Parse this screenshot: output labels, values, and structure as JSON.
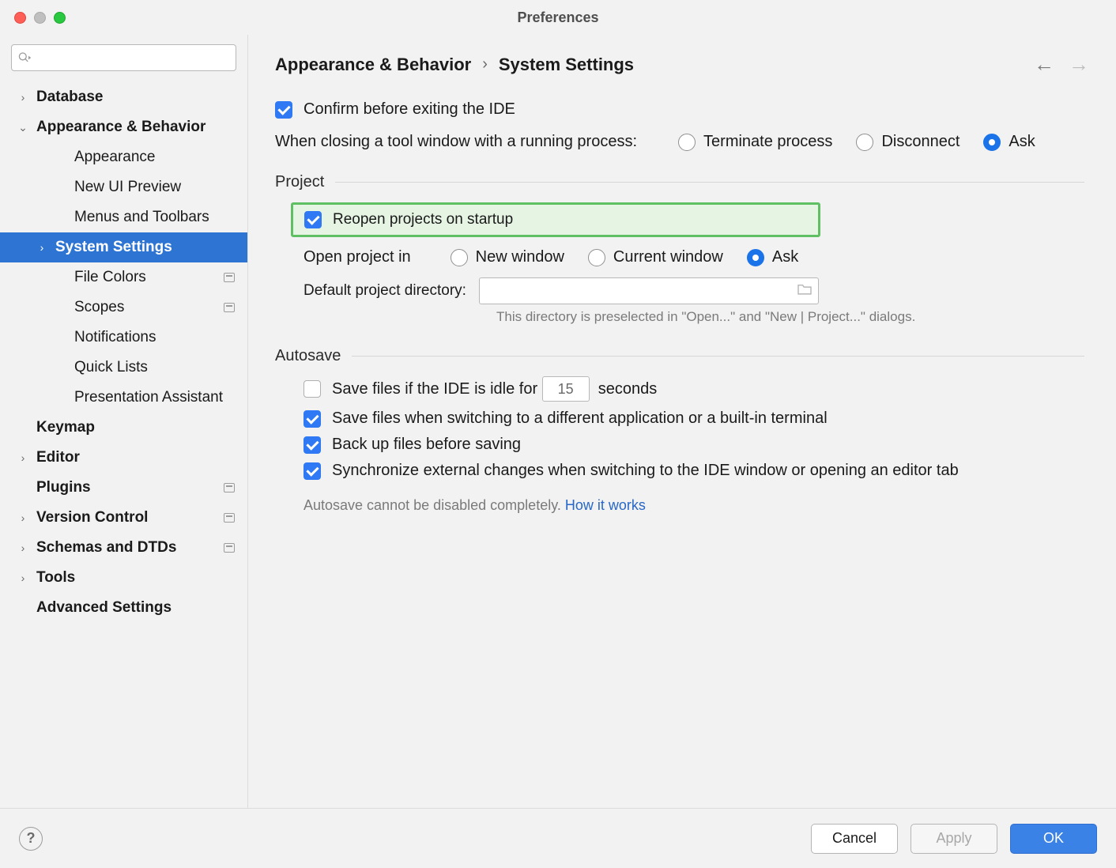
{
  "window": {
    "title": "Preferences"
  },
  "search": {
    "placeholder": ""
  },
  "sidebar": {
    "items": [
      {
        "label": "Database",
        "bold": true,
        "arrow": "right",
        "pad": 0
      },
      {
        "label": "Appearance & Behavior",
        "bold": true,
        "arrow": "down",
        "pad": 0
      },
      {
        "label": "Appearance",
        "bold": false,
        "arrow": "",
        "pad": 2
      },
      {
        "label": "New UI Preview",
        "bold": false,
        "arrow": "",
        "pad": 2
      },
      {
        "label": "Menus and Toolbars",
        "bold": false,
        "arrow": "",
        "pad": 2
      },
      {
        "label": "System Settings",
        "bold": true,
        "arrow": "right",
        "pad": 1,
        "selected": true
      },
      {
        "label": "File Colors",
        "bold": false,
        "arrow": "",
        "pad": 2,
        "badge": true
      },
      {
        "label": "Scopes",
        "bold": false,
        "arrow": "",
        "pad": 2,
        "badge": true
      },
      {
        "label": "Notifications",
        "bold": false,
        "arrow": "",
        "pad": 2
      },
      {
        "label": "Quick Lists",
        "bold": false,
        "arrow": "",
        "pad": 2
      },
      {
        "label": "Presentation Assistant",
        "bold": false,
        "arrow": "",
        "pad": 2
      },
      {
        "label": "Keymap",
        "bold": true,
        "arrow": "",
        "pad": 0,
        "noarrow": true
      },
      {
        "label": "Editor",
        "bold": true,
        "arrow": "right",
        "pad": 0
      },
      {
        "label": "Plugins",
        "bold": true,
        "arrow": "",
        "pad": 0,
        "noarrow": true,
        "badge": true
      },
      {
        "label": "Version Control",
        "bold": true,
        "arrow": "right",
        "pad": 0,
        "badge": true
      },
      {
        "label": "Schemas and DTDs",
        "bold": true,
        "arrow": "right",
        "pad": 0,
        "badge": true
      },
      {
        "label": "Tools",
        "bold": true,
        "arrow": "right",
        "pad": 0
      },
      {
        "label": "Advanced Settings",
        "bold": true,
        "arrow": "",
        "pad": 0,
        "noarrow": true
      }
    ]
  },
  "breadcrumb": {
    "a": "Appearance & Behavior",
    "sep": "›",
    "b": "System Settings"
  },
  "confirm_exit": "Confirm before exiting the IDE",
  "close_tool": {
    "label": "When closing a tool window with a running process:",
    "opts": [
      "Terminate process",
      "Disconnect",
      "Ask"
    ],
    "selected": 2
  },
  "sections": {
    "project": "Project",
    "autosave": "Autosave"
  },
  "project": {
    "reopen": "Reopen projects on startup",
    "open_in_label": "Open project in",
    "open_in_opts": [
      "New window",
      "Current window",
      "Ask"
    ],
    "open_in_selected": 2,
    "dir_label": "Default project directory:",
    "dir_value": "",
    "dir_hint": "This directory is preselected in \"Open...\" and \"New | Project...\" dialogs."
  },
  "autosave": {
    "idle_label_pre": "Save files if the IDE is idle for",
    "idle_value": "15",
    "idle_label_post": "seconds",
    "switch_app": "Save files when switching to a different application or a built-in terminal",
    "backup": "Back up files before saving",
    "sync": "Synchronize external changes when switching to the IDE window or opening an editor tab",
    "note_text": "Autosave cannot be disabled completely. ",
    "note_link": "How it works"
  },
  "footer": {
    "cancel": "Cancel",
    "apply": "Apply",
    "ok": "OK"
  }
}
